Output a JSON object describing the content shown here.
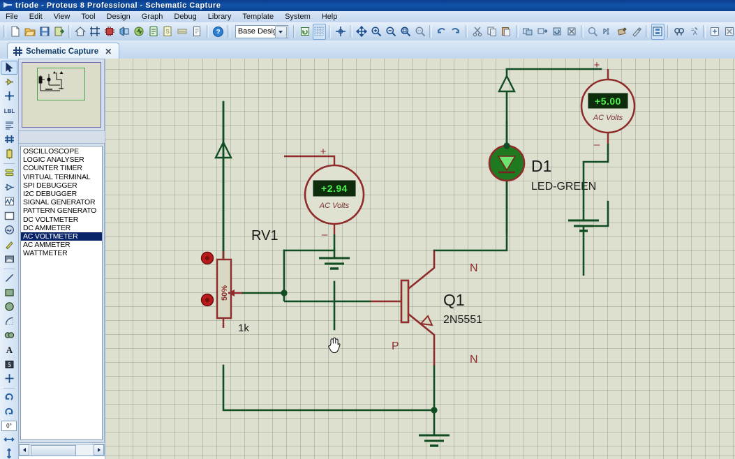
{
  "window": {
    "title": "triode - Proteus 8 Professional - Schematic Capture",
    "icon": "proteus-logo-icon"
  },
  "menubar": {
    "items": [
      {
        "label": "File",
        "name": "menu-file"
      },
      {
        "label": "Edit",
        "name": "menu-edit"
      },
      {
        "label": "View",
        "name": "menu-view"
      },
      {
        "label": "Tool",
        "name": "menu-tool"
      },
      {
        "label": "Design",
        "name": "menu-design"
      },
      {
        "label": "Graph",
        "name": "menu-graph"
      },
      {
        "label": "Debug",
        "name": "menu-debug"
      },
      {
        "label": "Library",
        "name": "menu-library"
      },
      {
        "label": "Template",
        "name": "menu-template"
      },
      {
        "label": "System",
        "name": "menu-system"
      },
      {
        "label": "Help",
        "name": "menu-help"
      }
    ]
  },
  "toolbar": {
    "design_selector_value": "Base Design",
    "buttons": [
      "new-document-icon",
      "open-folder-icon",
      "save-icon",
      "import-export-icon",
      "home-icon",
      "schematic-capture-icon",
      "pcb-layout-icon",
      "3d-viewer-icon",
      "simulation-icon",
      "bill-of-materials-icon",
      "design-explorer-icon",
      "gerber-viewer-icon",
      "report-icon",
      "help-icon"
    ],
    "buttons_right": [
      "refresh-icon",
      "toggle-grid-icon",
      "origin-icon",
      "pan-icon",
      "zoom-in-icon",
      "zoom-out-icon",
      "zoom-area-icon",
      "zoom-all-icon",
      "undo-icon",
      "redo-icon",
      "cut-icon",
      "copy-icon",
      "paste-icon",
      "block-copy-icon",
      "block-move-icon",
      "block-rotate-icon",
      "block-delete-icon",
      "pick-device-icon",
      "make-device-icon",
      "packaging-tool-icon",
      "decompose-icon",
      "toggle-properties-icon",
      "search-icon",
      "property-assignment-icon",
      "new-sheet-icon",
      "remove-sheet-icon"
    ]
  },
  "tab": {
    "label": "Schematic Capture",
    "close_label": "✕",
    "icon": "schematic-tab-icon"
  },
  "left_toolbar": {
    "tools": [
      {
        "name": "selection-mode-tool",
        "glyph": "arrow"
      },
      {
        "name": "component-mode-tool",
        "glyph": "component"
      },
      {
        "name": "junction-dot-tool",
        "glyph": "junction"
      },
      {
        "name": "wire-label-tool",
        "glyph": "label"
      },
      {
        "name": "text-script-tool",
        "glyph": "script"
      },
      {
        "name": "buses-tool",
        "glyph": "bus"
      },
      {
        "name": "subcircuit-tool",
        "glyph": "subckt"
      },
      {
        "name": "terminals-mode-tool",
        "glyph": "terminal"
      },
      {
        "name": "device-pins-tool",
        "glyph": "pin"
      },
      {
        "name": "graph-mode-tool",
        "glyph": "graph"
      },
      {
        "name": "tape-recorder-tool",
        "glyph": "tape"
      },
      {
        "name": "generator-mode-tool",
        "glyph": "generator"
      },
      {
        "name": "voltage-probe-tool",
        "glyph": "probe"
      },
      {
        "name": "virtual-instruments-tool",
        "glyph": "instrument"
      },
      {
        "name": "line-tool",
        "glyph": "line"
      },
      {
        "name": "box-tool",
        "glyph": "box"
      },
      {
        "name": "circle-tool",
        "glyph": "circle"
      },
      {
        "name": "arc-tool",
        "glyph": "arc"
      },
      {
        "name": "path-tool",
        "glyph": "path"
      },
      {
        "name": "text-tool",
        "glyph": "text"
      },
      {
        "name": "symbol-tool",
        "glyph": "symbol"
      },
      {
        "name": "marker-tool",
        "glyph": "marker"
      },
      {
        "name": "rotate-clockwise-tool",
        "glyph": "rot-cw"
      },
      {
        "name": "rotate-anticlockwise-tool",
        "glyph": "rot-ccw"
      }
    ],
    "rotation_value": "0°",
    "mirror_tools": [
      "mirror-horizontal-tool",
      "mirror-vertical-tool"
    ]
  },
  "instrument_list": {
    "selected": "AC VOLTMETER",
    "items": [
      "OSCILLOSCOPE",
      "LOGIC ANALYSER",
      "COUNTER TIMER",
      "VIRTUAL TERMINAL",
      "SPI DEBUGGER",
      "I2C DEBUGGER",
      "SIGNAL GENERATOR",
      "PATTERN GENERATO",
      "DC VOLTMETER",
      "DC AMMETER",
      "AC VOLTMETER",
      "AC AMMETER",
      "WATTMETER"
    ]
  },
  "schematic": {
    "components": [
      {
        "name": "potentiometer-rv1",
        "ref": "RV1",
        "value": "1k",
        "wiper_label": "50%"
      },
      {
        "name": "transistor-q1",
        "ref": "Q1",
        "value": "2N5551",
        "region_labels": [
          "N",
          "P",
          "N"
        ]
      },
      {
        "name": "led-d1",
        "ref": "D1",
        "value": "LED-GREEN"
      }
    ],
    "meters": [
      {
        "name": "ac-voltmeter-base",
        "value": "+2.94",
        "caption": "AC Volts",
        "plus_label": "+",
        "minus_label": "–"
      },
      {
        "name": "ac-voltmeter-supply",
        "value": "+5.00",
        "caption": "AC Volts",
        "plus_label": "+",
        "minus_label": "–"
      }
    ]
  },
  "colors": {
    "canvas_bg": "#dde0cf",
    "wire_green": "#0f4d20",
    "component_red": "#8f2b2b",
    "meter_display": "#0d2d0d",
    "meter_text": "#4ef04e",
    "selection_blue": "#0a246a",
    "led_lit": "#1f7a1f"
  }
}
